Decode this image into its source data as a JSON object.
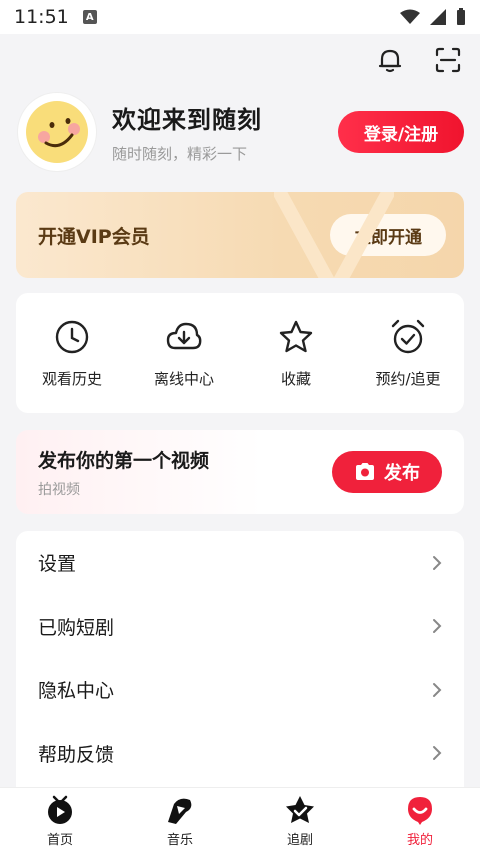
{
  "status_bar": {
    "time": "11:51"
  },
  "profile": {
    "welcome": "欢迎来到随刻",
    "subtitle": "随时随刻，精彩一下",
    "login_label": "登录/注册"
  },
  "vip": {
    "title": "开通VIP会员",
    "button_label": "立即开通"
  },
  "quick_actions": [
    {
      "label": "观看历史",
      "icon": "clock-icon"
    },
    {
      "label": "离线中心",
      "icon": "cloud-download-icon"
    },
    {
      "label": "收藏",
      "icon": "star-icon"
    },
    {
      "label": "预约/追更",
      "icon": "alarm-clock-icon"
    }
  ],
  "publish": {
    "title": "发布你的第一个视频",
    "subtitle": "拍视频",
    "button_label": "发布"
  },
  "settings": [
    {
      "label": "设置"
    },
    {
      "label": "已购短剧"
    },
    {
      "label": "隐私中心"
    },
    {
      "label": "帮助反馈"
    }
  ],
  "tabs": [
    {
      "label": "首页",
      "icon": "home-play-icon"
    },
    {
      "label": "音乐",
      "icon": "music-icon"
    },
    {
      "label": "追剧",
      "icon": "star-check-icon"
    },
    {
      "label": "我的",
      "icon": "profile-icon",
      "active": true
    }
  ],
  "colors": {
    "accent": "#f0213b",
    "vip_text": "#5a3a14"
  }
}
